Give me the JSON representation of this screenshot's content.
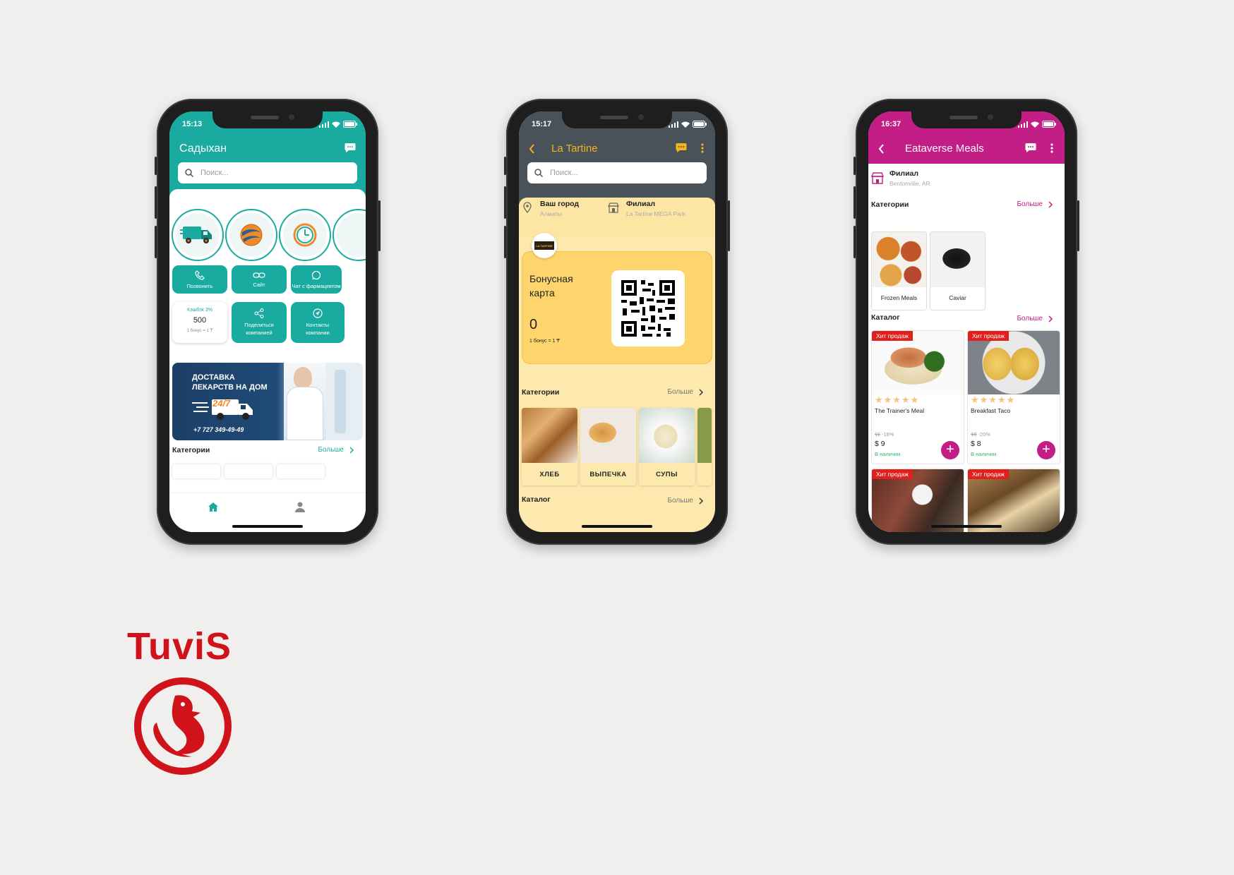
{
  "brand": {
    "name": "TuviS",
    "color": "#d0131b"
  },
  "phones": [
    {
      "id": "pharmacy",
      "accent": "#1aaba0",
      "status_time": "15:13",
      "title": "Садыхан",
      "search_placeholder": "Поиск...",
      "icons": [
        "delivery-truck-icon",
        "globe-logo-icon",
        "clock-icon"
      ],
      "actions": [
        {
          "label": "Позвонить",
          "icon": "phone-icon"
        },
        {
          "label": "Сайт",
          "icon": "link-icon"
        },
        {
          "label": "Чат с фармацевтом",
          "icon": "whatsapp-icon"
        }
      ],
      "cashback": {
        "title": "Кэшбэк 3%",
        "value": "500",
        "rate": "1 бонус = 1 ₸"
      },
      "share": "Поделиться компанией",
      "contacts": "Контакты компании",
      "banner": {
        "line1": "ДОСТАВКА",
        "line2": "ЛЕКАРСТВ НА ДОМ",
        "badge": "24/7",
        "phone": "+7 727 349-49-49"
      },
      "categories_title": "Категории",
      "more": "Больше"
    },
    {
      "id": "la-tartine",
      "accent": "#f4b41a",
      "status_time": "15:17",
      "title": "La Tartine",
      "search_placeholder": "Поиск...",
      "city_label": "Ваш город",
      "city_value": "Алматы",
      "branch_label": "Филиал",
      "branch_value": "La Tartine MEGA Park",
      "logo_text": "LA TARTINE",
      "bonus_title": "Бонусная карта",
      "bonus_value": "0",
      "bonus_rate": "1 бонус = 1 ₸",
      "categories_title": "Категории",
      "more": "Больше",
      "categories": [
        "ХЛЕБ",
        "ВЫПЕЧКА",
        "СУПЫ"
      ],
      "catalog_title": "Каталог"
    },
    {
      "id": "eataverse",
      "accent": "#c31d86",
      "status_time": "16:37",
      "title": "Eataverse Meals",
      "branch_label": "Филиал",
      "branch_value": "Bentonville, AR",
      "categories_title": "Категории",
      "more": "Больше",
      "categories": [
        "Frozen Meals",
        "Caviar"
      ],
      "catalog_title": "Каталог",
      "hit_label": "Хит продаж",
      "products": [
        {
          "name": "The Trainer's Meal",
          "old_price": "11",
          "discount": "-18%",
          "price": "$ 9",
          "stock": "В наличии",
          "rating": 5
        },
        {
          "name": "Breakfast Taco",
          "old_price": "10",
          "discount": "-20%",
          "price": "$ 8",
          "stock": "В наличии",
          "rating": 5
        }
      ]
    }
  ]
}
